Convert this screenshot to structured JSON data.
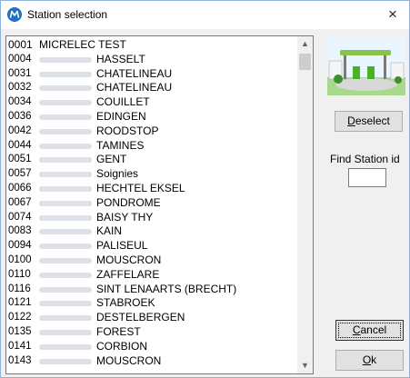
{
  "window": {
    "title": "Station selection",
    "close_glyph": "×"
  },
  "stations": [
    {
      "code": "0001",
      "name": "MICRELEC TEST"
    },
    {
      "code": "0004",
      "name": "HASSELT"
    },
    {
      "code": "0031",
      "name": "CHATELINEAU"
    },
    {
      "code": "0032",
      "name": "CHATELINEAU"
    },
    {
      "code": "0034",
      "name": "COUILLET"
    },
    {
      "code": "0036",
      "name": "EDINGEN"
    },
    {
      "code": "0042",
      "name": "ROODSTOP"
    },
    {
      "code": "0044",
      "name": "TAMINES"
    },
    {
      "code": "0051",
      "name": "GENT"
    },
    {
      "code": "0057",
      "name": "Soignies"
    },
    {
      "code": "0066",
      "name": "HECHTEL EKSEL"
    },
    {
      "code": "0067",
      "name": "PONDROME"
    },
    {
      "code": "0074",
      "name": "BAISY THY"
    },
    {
      "code": "0083",
      "name": "KAIN"
    },
    {
      "code": "0094",
      "name": "PALISEUL"
    },
    {
      "code": "0100",
      "name": "MOUSCRON"
    },
    {
      "code": "0110",
      "name": "ZAFFELARE"
    },
    {
      "code": "0116",
      "name": "SINT LENAARTS (BRECHT)"
    },
    {
      "code": "0121",
      "name": "STABROEK"
    },
    {
      "code": "0122",
      "name": "DESTELBERGEN"
    },
    {
      "code": "0135",
      "name": "FOREST"
    },
    {
      "code": "0141",
      "name": "CORBION"
    },
    {
      "code": "0143",
      "name": "MOUSCRON"
    }
  ],
  "buttons": {
    "deselect_mnemonic": "D",
    "deselect_rest": "eselect",
    "cancel_mnemonic": "C",
    "cancel_rest": "ancel",
    "ok_mnemonic": "O",
    "ok_rest": "k"
  },
  "find": {
    "label": "Find Station id",
    "value": ""
  },
  "icons": {
    "app": "micrelec-logo-icon",
    "image": "gas-station-illustration",
    "scroll_up": "▲",
    "scroll_down": "▼"
  },
  "colors": {
    "logo": "#1f6fc5",
    "accent_green": "#4caf2a"
  }
}
